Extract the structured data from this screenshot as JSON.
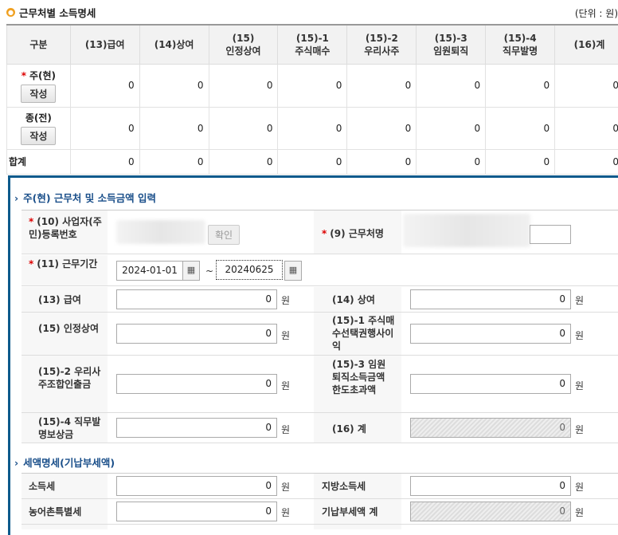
{
  "header": {
    "title": "근무처별 소득명세",
    "unit": "(단위 : 원)"
  },
  "summary": {
    "columns": [
      "구분",
      "(13)급여",
      "(14)상여",
      "(15)\n인정상여",
      "(15)-1\n주식매수",
      "(15)-2\n우리사주",
      "(15)-3\n임원퇴직",
      "(15)-4\n직무발명",
      "(16)계"
    ],
    "rows": [
      {
        "label": "주(현)",
        "required": true,
        "button": "작성",
        "values": [
          "0",
          "0",
          "0",
          "0",
          "0",
          "0",
          "0",
          "0"
        ]
      },
      {
        "label": "종(전)",
        "required": false,
        "button": "작성",
        "values": [
          "0",
          "0",
          "0",
          "0",
          "0",
          "0",
          "0",
          "0"
        ]
      },
      {
        "label": "합계",
        "required": false,
        "button": "",
        "values": [
          "0",
          "0",
          "0",
          "0",
          "0",
          "0",
          "0",
          "0"
        ]
      }
    ]
  },
  "form": {
    "section1_title": "주(현) 근무처 및 소득금액 입력",
    "biz_no_label": "(10) 사업자(주민)등록번호",
    "confirm_button": "확인",
    "workplace_label": "(9) 근무처명",
    "period_label": "(11) 근무기간",
    "period_start": "2024-01-01",
    "period_sep": "~",
    "period_end": "20240625",
    "won": "원",
    "fields": [
      {
        "label": "(13) 급여",
        "value": "0"
      },
      {
        "label": "(14) 상여",
        "value": "0"
      },
      {
        "label": "(15) 인정상여",
        "value": "0"
      },
      {
        "label": "(15)-1 주식매수선택권행사이익",
        "value": "0"
      },
      {
        "label": "(15)-2 우리사주조합인출금",
        "value": "0"
      },
      {
        "label": "(15)-3 임원퇴직소득금액 한도초과액",
        "value": "0"
      },
      {
        "label": "(15)-4 직무발명보상금",
        "value": "0"
      },
      {
        "label": "(16) 계",
        "value": "0"
      }
    ],
    "section2_title": "세액명세(기납부세액)",
    "tax_fields": [
      {
        "label": "소득세",
        "value": "0"
      },
      {
        "label": "지방소득세",
        "value": "0"
      },
      {
        "label": "농어촌특별세",
        "value": "0"
      },
      {
        "label": "기납부세액 계",
        "value": "0"
      }
    ]
  }
}
